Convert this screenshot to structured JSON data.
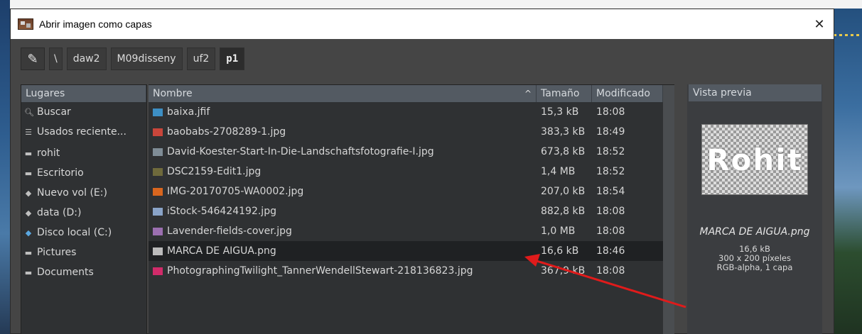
{
  "dialog": {
    "title": "Abrir imagen como capas",
    "close_glyph": "✕"
  },
  "breadcrumb": {
    "edit_glyph": "✎",
    "segments": [
      "\\",
      "daw2",
      "M09disseny",
      "uf2",
      "p1"
    ]
  },
  "places": {
    "header": "Lugares",
    "items": [
      {
        "label": "Buscar",
        "icon": "search-icon"
      },
      {
        "label": "Usados reciente...",
        "icon": "recent-icon"
      },
      {
        "label": "rohit",
        "icon": "folder-icon"
      },
      {
        "label": "Escritorio",
        "icon": "folder-icon"
      },
      {
        "label": "Nuevo vol (E:)",
        "icon": "drive-icon"
      },
      {
        "label": "data (D:)",
        "icon": "drive-icon"
      },
      {
        "label": "Disco local (C:)",
        "icon": "drive-icon"
      },
      {
        "label": "Pictures",
        "icon": "folder-icon"
      },
      {
        "label": "Documents",
        "icon": "folder-icon"
      }
    ]
  },
  "files": {
    "columns": {
      "name": "Nombre",
      "size": "Tamaño",
      "modified": "Modificado"
    },
    "sort_arrow": "^",
    "rows": [
      {
        "name": "baixa.jfif",
        "size": "15,3 kB",
        "modified": "18:08",
        "thumb_color": "#3d8fc4"
      },
      {
        "name": "baobabs-2708289-1.jpg",
        "size": "383,3 kB",
        "modified": "18:49",
        "thumb_color": "#c9463b"
      },
      {
        "name": "David-Koester-Start-In-Die-Landschaftsfotografie-I.jpg",
        "size": "673,8 kB",
        "modified": "18:52",
        "thumb_color": "#7f8c96"
      },
      {
        "name": "DSC2159-Edit1.jpg",
        "size": "1,4 MB",
        "modified": "18:52",
        "thumb_color": "#6f6a3c"
      },
      {
        "name": "IMG-20170705-WA0002.jpg",
        "size": "207,0 kB",
        "modified": "18:54",
        "thumb_color": "#d9661f"
      },
      {
        "name": "iStock-546424192.jpg",
        "size": "882,8 kB",
        "modified": "18:08",
        "thumb_color": "#8aa4c8"
      },
      {
        "name": "Lavender-fields-cover.jpg",
        "size": "1,0 MB",
        "modified": "18:08",
        "thumb_color": "#9b6fb0"
      },
      {
        "name": "MARCA DE AIGUA.png",
        "size": "16,6 kB",
        "modified": "18:46",
        "thumb_color": "#bbbbbb"
      },
      {
        "name": "PhotographingTwilight_TannerWendellStewart-218136823.jpg",
        "size": "367,9 kB",
        "modified": "18:08",
        "thumb_color": "#d12b6a"
      }
    ],
    "selected_index": 7
  },
  "preview": {
    "header": "Vista previa",
    "thumb_text": "Rohit",
    "filename": "MARCA DE AIGUA.png",
    "size": "16,6 kB",
    "dimensions": "300 x 200 píxeles",
    "mode": "RGB-alpha, 1 capa"
  },
  "colors": {
    "annotation_arrow": "#e01b1b",
    "selected_row": "#1f2123"
  }
}
